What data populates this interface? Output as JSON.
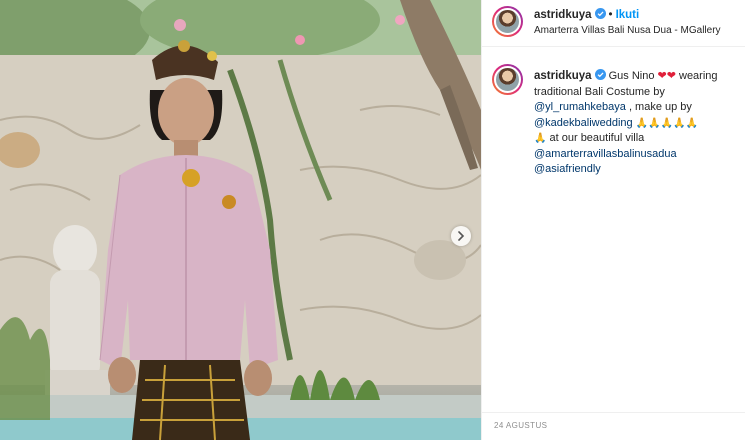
{
  "post": {
    "username": "astridkuya",
    "follow_label": "Ikuti",
    "separator": "•",
    "location": "Amarterra Villas Bali Nusa Dua - MGallery",
    "date": "24 AGUSTUS"
  },
  "caption": {
    "username": "astridkuya",
    "part1": " Gus Nino ",
    "hearts": "❤❤",
    "part2": " wearing traditional Bali Costume by ",
    "mention1": "@yl_rumahkebaya",
    "part3": " , make up by ",
    "mention2": "@kadekbaliwedding",
    "prays1": " 🙏🙏🙏🙏🙏",
    "prays2": "🙏",
    "part4": " at our beautiful villa ",
    "mention3": "@amarterravillasbalinusadua",
    "mention4": "@asiafriendly"
  },
  "icons": {
    "verified": "verified-badge-icon",
    "next": "chevron-right-icon"
  },
  "colors": {
    "follow_blue": "#0095f6",
    "mention_blue": "#00376b",
    "verified_blue": "#3897f0",
    "muted": "#8e8e8e"
  }
}
